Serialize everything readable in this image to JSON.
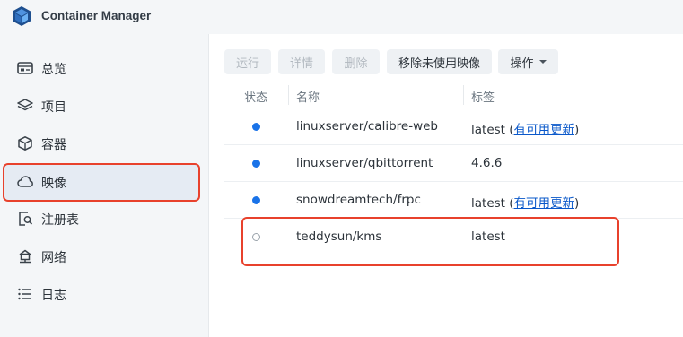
{
  "app": {
    "title": "Container Manager",
    "logo": "container-manager-logo"
  },
  "sidebar": {
    "items": [
      {
        "label": "总览",
        "icon": "overview-icon"
      },
      {
        "label": "项目",
        "icon": "layers-icon"
      },
      {
        "label": "容器",
        "icon": "cube-icon"
      },
      {
        "label": "映像",
        "icon": "cloud-icon",
        "active": true
      },
      {
        "label": "注册表",
        "icon": "registry-icon"
      },
      {
        "label": "网络",
        "icon": "network-icon"
      },
      {
        "label": "日志",
        "icon": "list-icon"
      }
    ]
  },
  "toolbar": {
    "run": "运行",
    "details": "详情",
    "delete": "删除",
    "remove_unused": "移除未使用映像",
    "actions": "操作"
  },
  "table": {
    "headers": {
      "status": "状态",
      "name": "名称",
      "tag": "标签"
    },
    "rows": [
      {
        "status": "running",
        "name": "linuxserver/calibre-web",
        "tag": "latest",
        "update_prefix": " (",
        "update": "有可用更新",
        "update_suffix": ")"
      },
      {
        "status": "running",
        "name": "linuxserver/qbittorrent",
        "tag": "4.6.6"
      },
      {
        "status": "running",
        "name": "snowdreamtech/frpc",
        "tag": "latest",
        "update_prefix": " (",
        "update": "有可用更新",
        "update_suffix": ")"
      },
      {
        "status": "stopped",
        "name": "teddysun/kms",
        "tag": "latest"
      }
    ]
  },
  "colors": {
    "accent": "#1a73e8",
    "highlight": "#e8412c",
    "sidebar_bg": "#f4f6f8",
    "active_bg": "#e5ebf3"
  }
}
